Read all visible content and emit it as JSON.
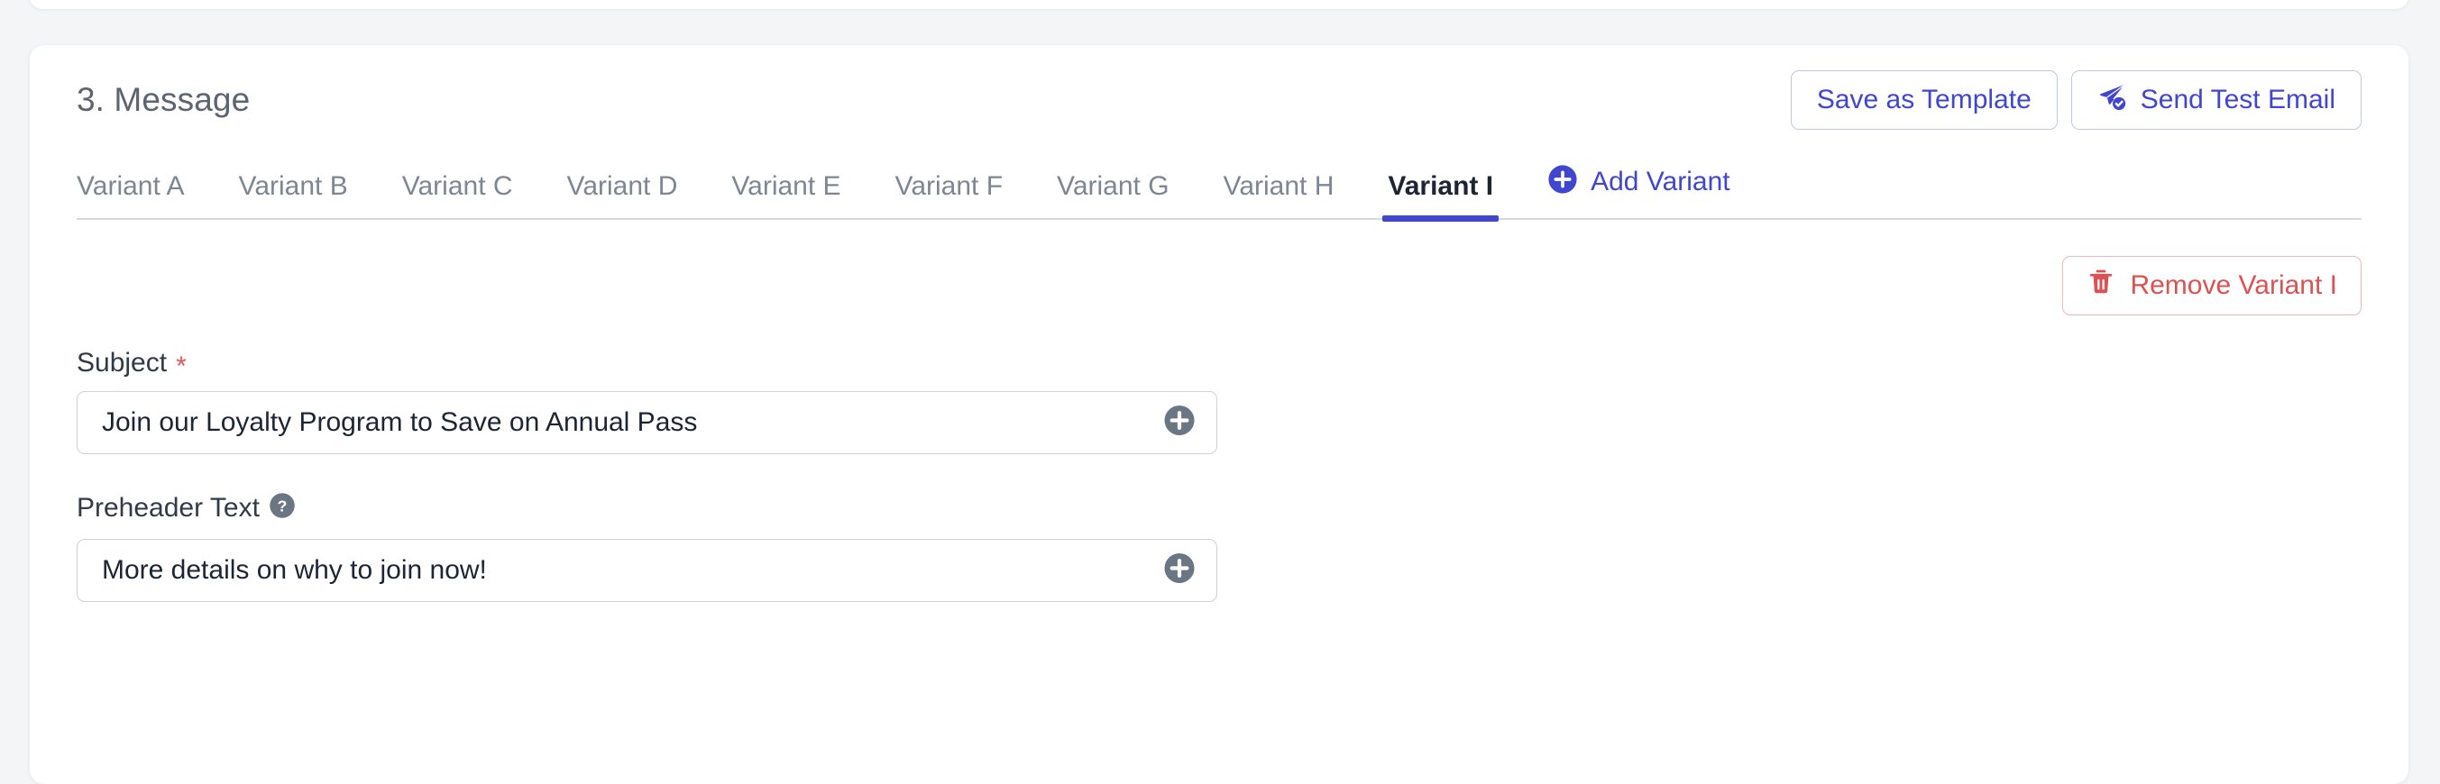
{
  "theme": {
    "page_bg": "#f4f5f7",
    "card_bg": "#ffffff",
    "accent_indigo": "#4046cd",
    "danger_red": "#dc5252",
    "required_star": "#e25757",
    "muted_text": "#7c8694",
    "title_text": "#5b6572",
    "icon_slate": "#6b7684",
    "border_indigo": "#c3c6ec",
    "border_red": "#f0b8b8",
    "input_border": "#ccd2da",
    "divider": "#d6d9e0"
  },
  "header": {
    "title": "3. Message",
    "save_as_template_label": "Save as Template",
    "send_test_email_label": "Send Test Email",
    "send_test_email_icon": "paper-plane-check-icon"
  },
  "tabs": {
    "items": [
      {
        "label": "Variant A",
        "active": false
      },
      {
        "label": "Variant B",
        "active": false
      },
      {
        "label": "Variant C",
        "active": false
      },
      {
        "label": "Variant D",
        "active": false
      },
      {
        "label": "Variant E",
        "active": false
      },
      {
        "label": "Variant F",
        "active": false
      },
      {
        "label": "Variant G",
        "active": false
      },
      {
        "label": "Variant H",
        "active": false
      },
      {
        "label": "Variant I",
        "active": true
      }
    ],
    "add_variant_label": "Add Variant",
    "add_variant_icon": "plus-circle-icon"
  },
  "actions": {
    "remove_variant_label": "Remove Variant I",
    "remove_variant_icon": "trash-icon"
  },
  "form": {
    "subject": {
      "label": "Subject",
      "required_marker": "*",
      "value": "Join our Loyalty Program to Save on Annual Pass",
      "placeholder": "Subject",
      "insert_icon": "plus-circle-filled-icon"
    },
    "preheader": {
      "label": "Preheader Text",
      "help_icon": "question-circle-icon",
      "value": "More details on why to join now!",
      "placeholder": "Preheader Text",
      "insert_icon": "plus-circle-filled-icon"
    }
  }
}
